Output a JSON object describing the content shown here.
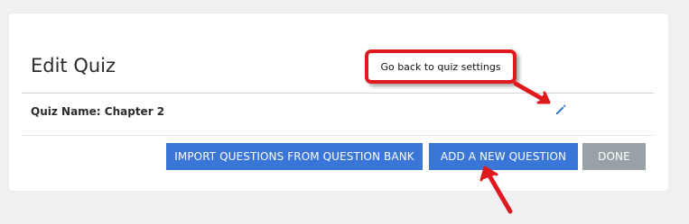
{
  "editor": {
    "title": "Edit Quiz",
    "quiz_name_label": "Quiz Name: Chapter 2"
  },
  "icons": {
    "edit": "pencil-icon"
  },
  "buttons": {
    "import_label": "IMPORT QUESTIONS FROM QUESTION BANK",
    "add_label": "ADD A NEW QUESTION",
    "done_label": "DONE"
  },
  "annotation": {
    "callout_text": "Go back to quiz settings"
  },
  "colors": {
    "primary_button": "#3a75d8",
    "done_button": "#98a2a6",
    "annotation_red": "#e0191f",
    "background": "#eef0f2"
  }
}
